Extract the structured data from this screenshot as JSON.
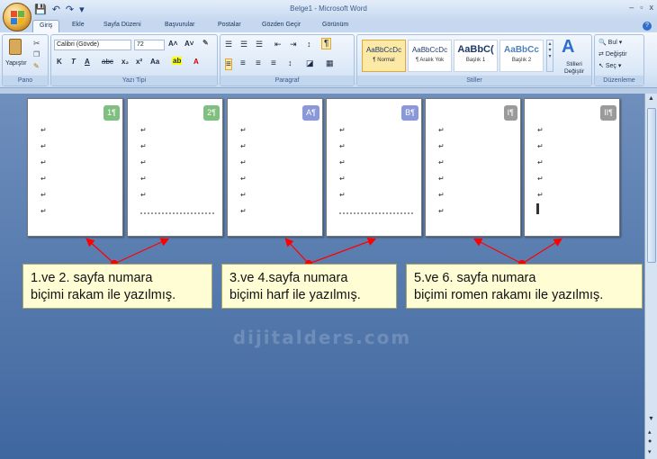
{
  "window": {
    "title": "Belge1 - Microsoft Word",
    "controls": [
      "–",
      "▫",
      "x"
    ]
  },
  "tabs": [
    "Giriş",
    "Ekle",
    "Sayfa Düzeni",
    "Başvurular",
    "Postalar",
    "Gözden Geçir",
    "Görünüm"
  ],
  "ribbon": {
    "pano": {
      "name": "Pano",
      "paste": "Yapıştır"
    },
    "font": {
      "name": "Yazı Tipi",
      "family": "Calibri (Gövde)",
      "size": "72"
    },
    "paragraph": {
      "name": "Paragraf"
    },
    "styles": {
      "name": "Stiller",
      "items": [
        {
          "sample": "AaBbCcDc",
          "label": "¶ Normal"
        },
        {
          "sample": "AaBbCcDc",
          "label": "¶ Aralık Yok"
        },
        {
          "sample": "AaBbC(",
          "label": "Başlık 1"
        },
        {
          "sample": "AaBbCc",
          "label": "Başlık 2"
        }
      ],
      "change": "Stilleri Değiştir"
    },
    "editing": {
      "name": "Düzenleme",
      "find": "Bul",
      "replace": "Değiştir",
      "select": "Seç"
    }
  },
  "pages": [
    {
      "badge": "1¶",
      "color": "green"
    },
    {
      "badge": "2¶",
      "color": "green"
    },
    {
      "badge": "A¶",
      "color": "blue"
    },
    {
      "badge": "B¶",
      "color": "blue"
    },
    {
      "badge": "I¶",
      "color": "gray"
    },
    {
      "badge": "II¶",
      "color": "gray"
    }
  ],
  "callouts": [
    {
      "line1": "1.ve 2. sayfa numara",
      "line2": "biçimi rakam ile yazılmış."
    },
    {
      "line1": "3.ve 4.sayfa numara",
      "line2": "biçimi harf ile yazılmış."
    },
    {
      "line1": "5.ve 6. sayfa numara",
      "line2": "biçimi romen rakamı ile yazılmış."
    }
  ],
  "watermark": "dijitalders.com",
  "colors": {
    "accent": "#ff0000",
    "ribbon": "#dbe8f7",
    "docbg": "#5a7fb3"
  }
}
